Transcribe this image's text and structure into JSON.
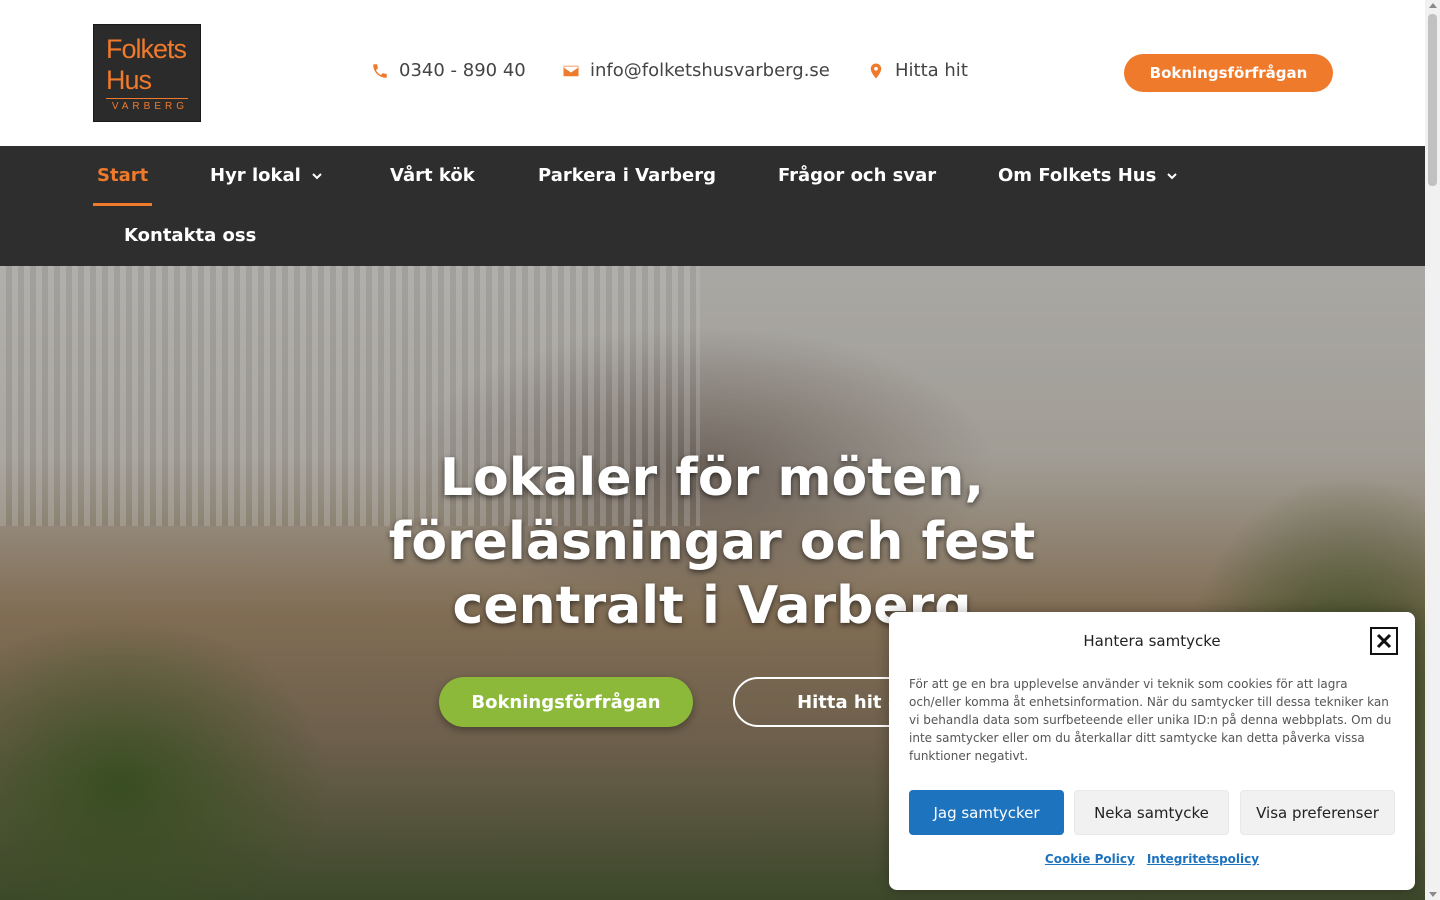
{
  "logo": {
    "line1": "Folkets",
    "line2": "Hus",
    "line3": "VARBERG"
  },
  "header": {
    "phone": "0340 - 890 40",
    "email": "info@folketshusvarberg.se",
    "directions": "Hitta hit",
    "booking_button": "Bokningsförfrågan"
  },
  "nav": {
    "items": [
      {
        "label": "Start",
        "active": true
      },
      {
        "label": "Hyr lokal",
        "dropdown": true
      },
      {
        "label": "Vårt kök"
      },
      {
        "label": "Parkera i Varberg"
      },
      {
        "label": "Frågor och svar"
      },
      {
        "label": "Om Folkets Hus",
        "dropdown": true
      },
      {
        "label": "Kontakta oss"
      }
    ]
  },
  "hero": {
    "title": "Lokaler för möten, föreläsningar och fest centralt i Varberg",
    "primary_button": "Bokningsförfrågan",
    "secondary_button": "Hitta hit & P"
  },
  "cookie": {
    "title": "Hantera samtycke",
    "text": "För att ge en bra upplevelse använder vi teknik som cookies för att lagra och/eller komma åt enhetsinformation. När du samtycker till dessa tekniker kan vi behandla data som surfbeteende eller unika ID:n på denna webbplats. Om du inte samtycker eller om du återkallar ditt samtycke kan detta påverka vissa funktioner negativt.",
    "accept": "Jag samtycker",
    "deny": "Neka samtycke",
    "preferences": "Visa preferenser",
    "links": [
      "Cookie Policy",
      "Integritetspolicy"
    ]
  },
  "colors": {
    "accent": "#f07a2c",
    "nav_bg": "#2e2e2e",
    "hero_green": "#8cb93a",
    "cookie_blue": "#1e73be"
  }
}
